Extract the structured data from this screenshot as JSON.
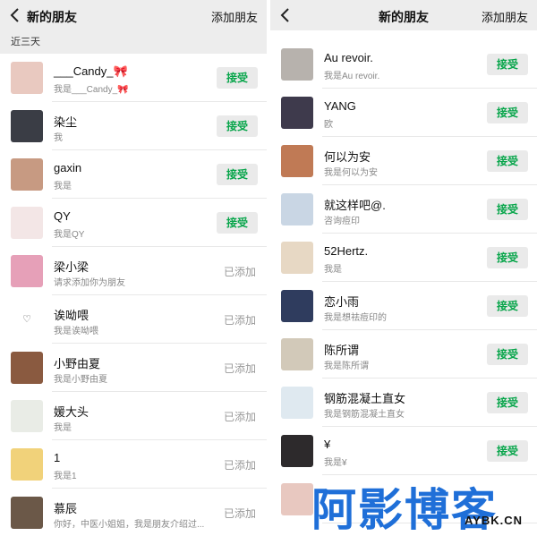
{
  "left": {
    "header": {
      "title": "新的朋友",
      "action": "添加朋友"
    },
    "section": "近三天",
    "rows": [
      {
        "name": "___Candy_🎀",
        "msg": "我是___Candy_🎀",
        "status": "接受",
        "type": "accept",
        "color": "#e9c9c0"
      },
      {
        "name": "染尘",
        "msg": "我",
        "status": "接受",
        "type": "accept",
        "color": "#3a3d45"
      },
      {
        "name": "gaxin",
        "msg": "我是",
        "status": "接受",
        "type": "accept",
        "color": "#c79a82"
      },
      {
        "name": "QY",
        "msg": "我是QY",
        "status": "接受",
        "type": "accept",
        "color": "#f3e6e6"
      },
      {
        "name": "梁小梁",
        "msg": "请求添加你为朋友",
        "status": "已添加",
        "type": "added",
        "color": "#e6a0b8"
      },
      {
        "name": "诶呦喂",
        "msg": "我是诶呦喂",
        "status": "已添加",
        "type": "added",
        "color": "#ffffff"
      },
      {
        "name": "小野由夏",
        "msg": "我是小野由夏",
        "status": "已添加",
        "type": "added",
        "color": "#8a5a40"
      },
      {
        "name": "媛大头",
        "msg": "我是",
        "status": "已添加",
        "type": "added",
        "color": "#e9ece6"
      },
      {
        "name": "1",
        "msg": "我是1",
        "status": "已添加",
        "type": "added",
        "color": "#f1d27a"
      },
      {
        "name": "慕辰",
        "msg": "你好，中医小姐姐，我是朋友介绍过...",
        "status": "已添加",
        "type": "added",
        "color": "#6b5848"
      }
    ]
  },
  "right": {
    "header": {
      "title": "新的朋友",
      "action": "添加朋友"
    },
    "rows": [
      {
        "name": "Au revoir.",
        "msg": "我是Au revoir.",
        "status": "接受",
        "type": "accept",
        "color": "#b7b2ad"
      },
      {
        "name": "YANG",
        "msg": "欧",
        "status": "接受",
        "type": "accept",
        "color": "#3e3a4c"
      },
      {
        "name": "何以为安",
        "msg": "我是何以为安",
        "status": "接受",
        "type": "accept",
        "color": "#c07a55"
      },
      {
        "name": "就这样吧@.",
        "msg": "咨询痘印",
        "status": "接受",
        "type": "accept",
        "color": "#c9d6e4"
      },
      {
        "name": "52Hertz.",
        "msg": "我是",
        "status": "接受",
        "type": "accept",
        "color": "#e7d8c4"
      },
      {
        "name": "恋小雨",
        "msg": "我是想祛痘印的",
        "status": "接受",
        "type": "accept",
        "color": "#2f3c5e"
      },
      {
        "name": "陈所谓",
        "msg": "我是陈所谓",
        "status": "接受",
        "type": "accept",
        "color": "#d2c9b9"
      },
      {
        "name": "钢筋混凝土直女",
        "msg": "我是钢筋混凝土直女",
        "status": "接受",
        "type": "accept",
        "color": "#dfe9f0"
      },
      {
        "name": "¥",
        "msg": "我是¥",
        "status": "接受",
        "type": "accept",
        "color": "#2d2a2c"
      },
      {
        "name": "",
        "msg": "",
        "status": "",
        "type": "none",
        "color": "#e8c8c0"
      }
    ]
  },
  "watermark": {
    "text": "阿影博客",
    "sub": "AYBK.CN",
    "color": "#1f6fd8"
  }
}
